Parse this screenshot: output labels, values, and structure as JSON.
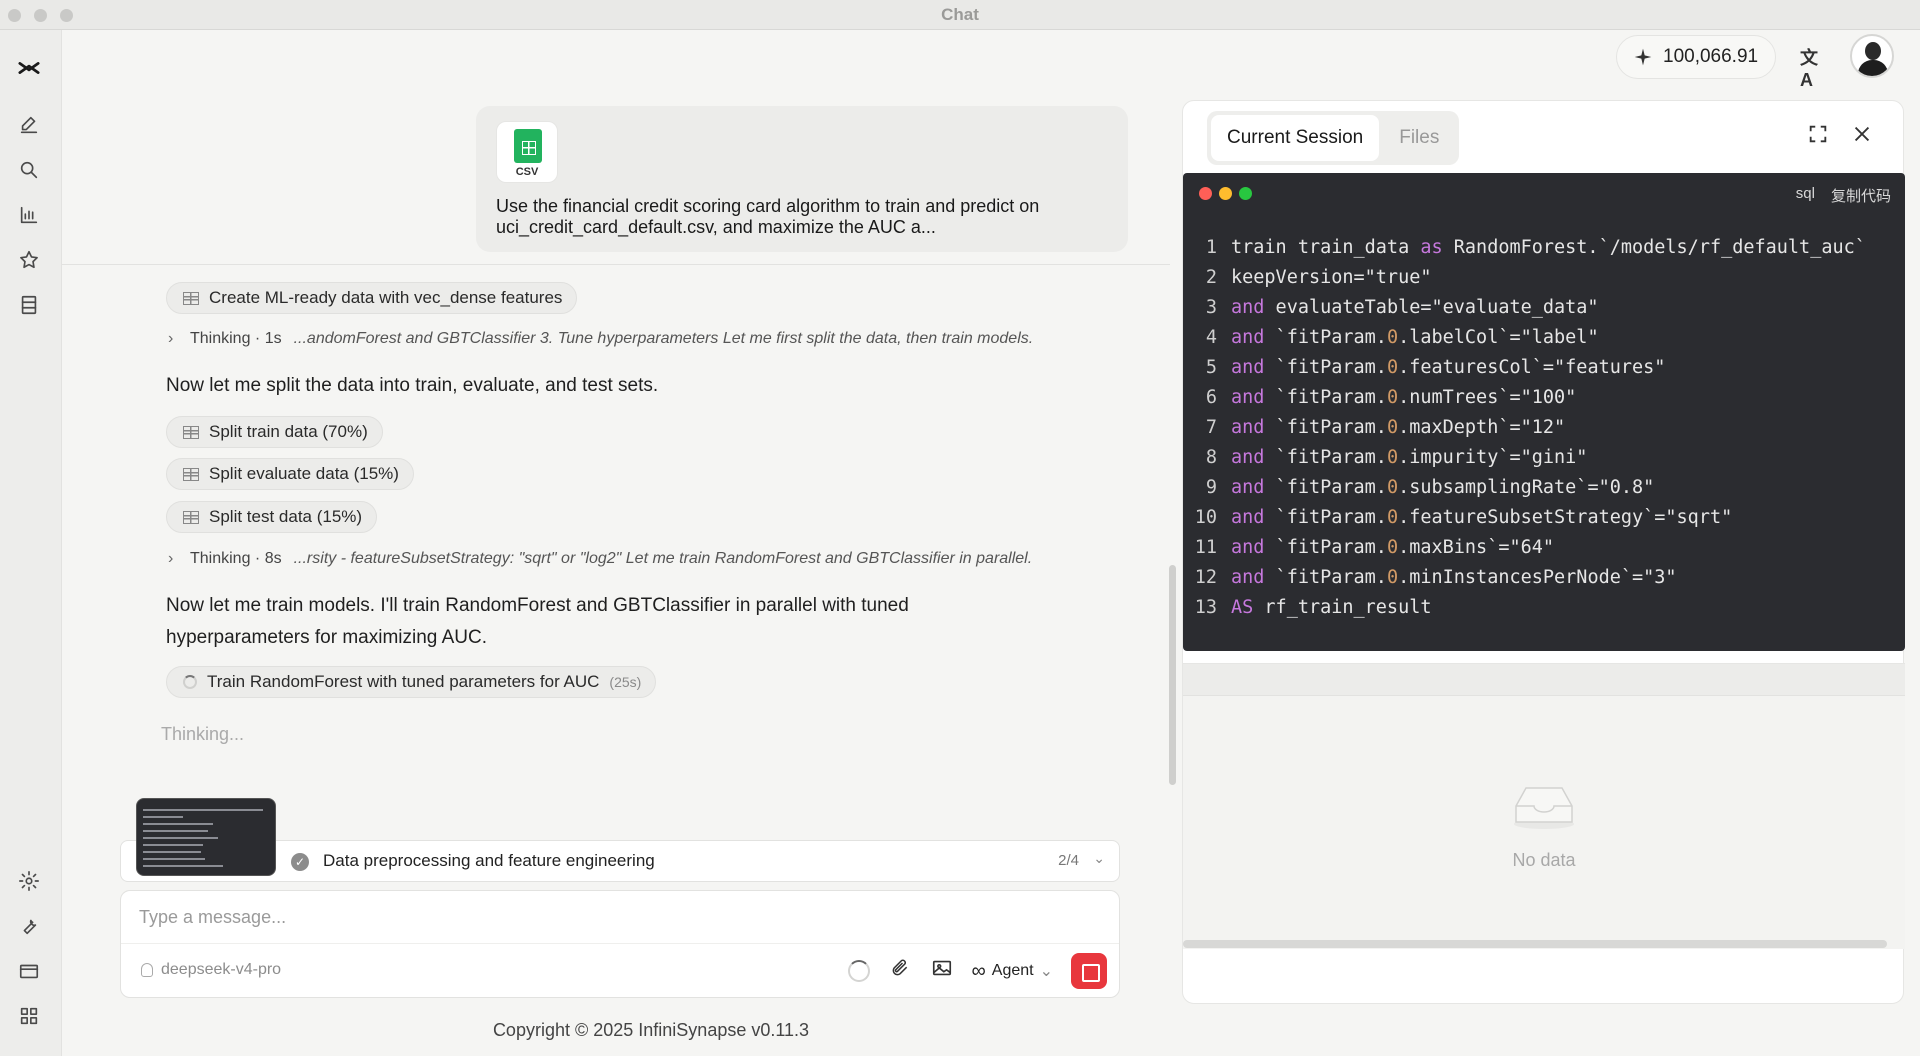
{
  "window": {
    "title": "Chat"
  },
  "sidebar": {
    "icons": [
      "logo-icon",
      "new-chat-icon",
      "search-icon",
      "chart-icon",
      "star-icon",
      "table-icon",
      "settings-icon",
      "wrench-icon",
      "card-icon",
      "grid-icon"
    ]
  },
  "header": {
    "credits": "100,066.91",
    "translate_label": "文A"
  },
  "user_message": {
    "attachment_label": "CSV",
    "text": "Use the financial credit scoring card algorithm to train and predict on uci_credit_card_default.csv, and maximize the AUC a..."
  },
  "steps": {
    "chip1": "Create ML-ready data with vec_dense features",
    "thinking1": {
      "label": "Thinking · 1s",
      "snippet": "...andomForest and GBTClassifier 3. Tune hyperparameters Let me first split the data, then train models."
    },
    "para1": "Now let me split the data into train, evaluate, and test sets.",
    "chip_split_train": "Split train data (70%)",
    "chip_split_eval": "Split evaluate data (15%)",
    "chip_split_test": "Split test data (15%)",
    "thinking2": {
      "label": "Thinking · 8s",
      "snippet": "...rsity - featureSubsetStrategy: \"sqrt\" or \"log2\" Let me train RandomForest and GBTClassifier in parallel."
    },
    "para2": "Now let me train models. I'll train RandomForest and GBTClassifier in parallel with tuned hyperparameters for maximizing AUC.",
    "chip_train": "Train RandomForest with tuned parameters for AUC",
    "chip_train_duration": "(25s)",
    "thinking_now": "Thinking..."
  },
  "task_bar": {
    "label": "Data preprocessing and feature engineering",
    "count": "2/4"
  },
  "composer": {
    "placeholder": "Type a message...",
    "model": "deepseek-v4-pro",
    "mode": "Agent"
  },
  "footer": {
    "copyright": "Copyright © 2025 InfiniSynapse v0.11.3"
  },
  "panel": {
    "tabs": [
      "Current Session",
      "Files"
    ],
    "code": {
      "language": "sql",
      "copy_label": "复制代码",
      "lines": [
        "train train_data as RandomForest.`/models/rf_default_auc`",
        "keepVersion=\"true\"",
        "and evaluateTable=\"evaluate_data\"",
        "and `fitParam.0.labelCol`=\"label\"",
        "and `fitParam.0.featuresCol`=\"features\"",
        "and `fitParam.0.numTrees`=\"100\"",
        "and `fitParam.0.maxDepth`=\"12\"",
        "and `fitParam.0.impurity`=\"gini\"",
        "and `fitParam.0.subsamplingRate`=\"0.8\"",
        "and `fitParam.0.featureSubsetStrategy`=\"sqrt\"",
        "and `fitParam.0.maxBins`=\"64\"",
        "and `fitParam.0.minInstancesPerNode`=\"3\"",
        "AS rf_train_result"
      ]
    },
    "result": {
      "empty_label": "No data"
    }
  },
  "colors": {
    "stop_button": "#e8373d",
    "code_bg": "#2b2c30",
    "keyword": "#c678dd",
    "number": "#d19a66"
  }
}
